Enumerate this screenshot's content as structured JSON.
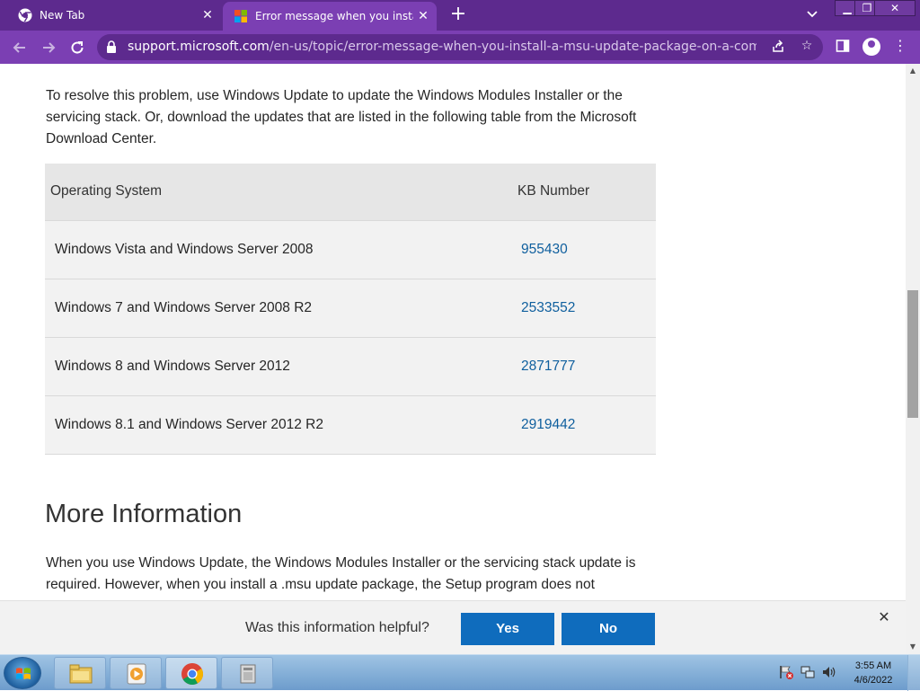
{
  "browser": {
    "tabs": [
      {
        "title": "New Tab",
        "icon": "chrome-icon",
        "active": false
      },
      {
        "title": "Error message when you install a",
        "icon": "microsoft-logo-icon",
        "active": true
      }
    ],
    "url_host": "support.microsoft.com",
    "url_path": "/en-us/topic/error-message-when-you-install-a-msu-update-package-on-a-computer-th...",
    "accent": "#7b3fb3",
    "titlebar_color": "#5d2a8e"
  },
  "article": {
    "intro": "To resolve this problem, use Windows Update to update the Windows Modules Installer or the servicing stack. Or, download the updates that are listed in the following table from the Microsoft Download Center.",
    "table": {
      "headers": [
        "Operating System",
        "KB Number"
      ],
      "rows": [
        {
          "os": "Windows Vista and Windows Server 2008",
          "kb": "955430"
        },
        {
          "os": "Windows 7 and Windows Server 2008 R2",
          "kb": "2533552"
        },
        {
          "os": "Windows 8 and Windows Server 2012",
          "kb": "2871777"
        },
        {
          "os": "Windows 8.1 and Windows Server 2012 R2",
          "kb": "2919442"
        }
      ]
    },
    "more_info_heading": "More Information",
    "more_info_text": "When you use Windows Update, the Windows Modules Installer or the servicing stack update is required. However, when you install a .msu update package, the Setup program does not",
    "link_color": "#0f5f9e"
  },
  "feedback": {
    "question": "Was this information helpful?",
    "yes_label": "Yes",
    "no_label": "No",
    "button_color": "#0f6cbd"
  },
  "taskbar": {
    "time": "3:55 AM",
    "date": "4/6/2022"
  }
}
